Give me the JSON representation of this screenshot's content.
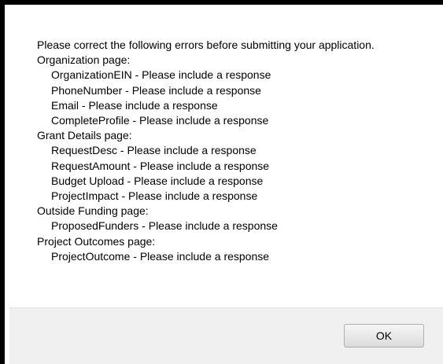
{
  "dialog": {
    "intro": "Please correct the following errors before submitting your application.",
    "sections": [
      {
        "heading": "Organization page:",
        "items": [
          "OrganizationEIN - Please include a response",
          "PhoneNumber - Please include a response",
          "Email - Please include a response",
          "CompleteProfile - Please include a response"
        ]
      },
      {
        "heading": "Grant Details page:",
        "items": [
          "RequestDesc - Please include a response",
          "RequestAmount - Please include a response",
          "Budget Upload - Please include a response",
          "ProjectImpact - Please include a response"
        ]
      },
      {
        "heading": "Outside Funding page:",
        "items": [
          "ProposedFunders - Please include a response"
        ]
      },
      {
        "heading": "Project Outcomes page:",
        "items": [
          "ProjectOutcome - Please include a response"
        ]
      }
    ],
    "ok_label": "OK"
  }
}
